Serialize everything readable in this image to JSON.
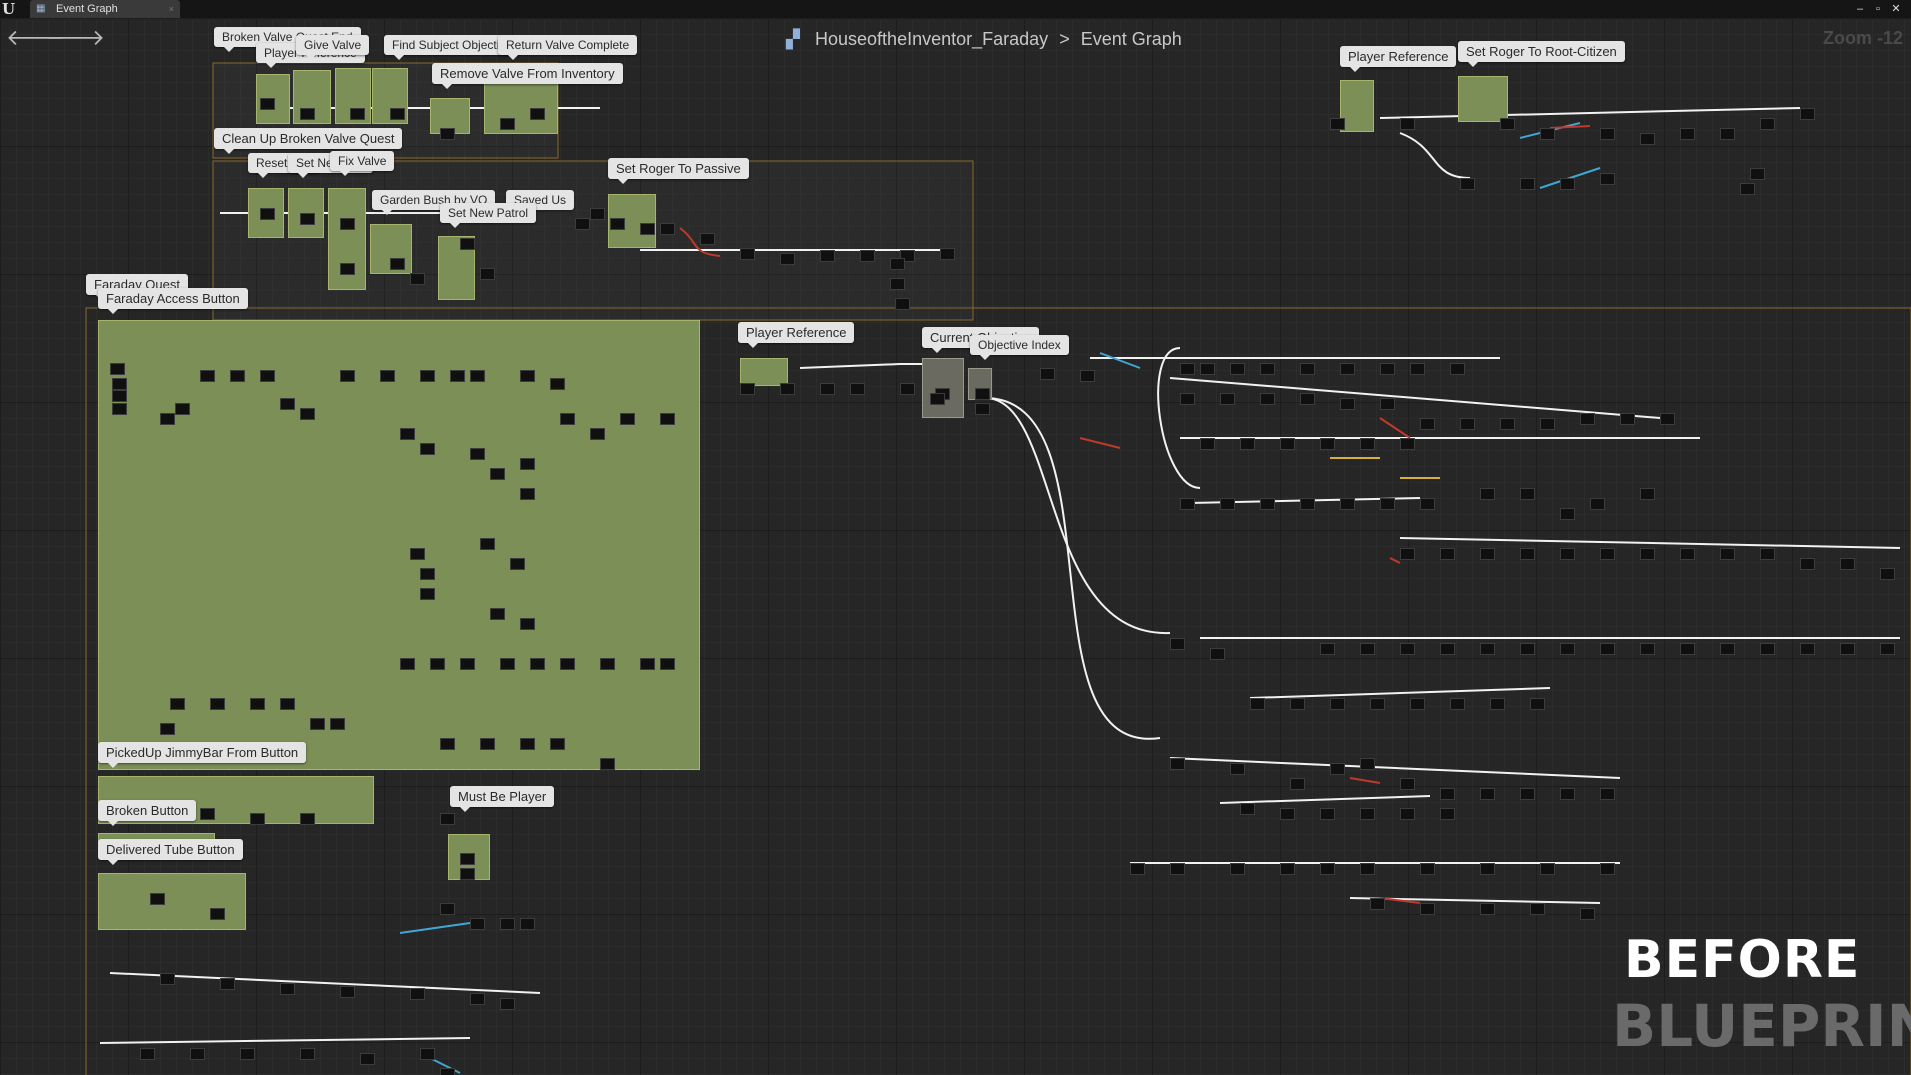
{
  "window": {
    "tab_label": "Event Graph",
    "tab_icon": "event-graph-icon",
    "close_glyph": "×",
    "controls": [
      "–",
      "▫",
      "✕"
    ]
  },
  "toolbar": {
    "back_icon": "arrow-left-icon",
    "forward_icon": "arrow-right-icon",
    "back_glyph": "🡐",
    "forward_glyph": "🡒"
  },
  "breadcrumb": {
    "icon": "blueprint-class-icon",
    "icon_glyph": "▞",
    "asset": "HouseoftheInventor_Faraday",
    "separator": ">",
    "graph": "Event Graph"
  },
  "zoom_label": "Zoom -12",
  "comments": [
    "Broken Valve Quest End",
    "Player Reference",
    "Give Valve",
    "Find Subject Objective",
    "Return Valve Complete",
    "Remove Valve From Inventory",
    "Clean Up Broken Valve Quest",
    "Reset Plot",
    "Set New Plot",
    "Fix Valve",
    "Garden Bush by VO",
    "Saved Us",
    "Set New Patrol",
    "Set Roger To Passive",
    "Player Reference",
    "Set Roger To Root-Citizen",
    "Faraday Quest",
    "Faraday Access Button",
    "Player Reference",
    "Current Objective",
    "Objective Index",
    "PickedUp JimmyBar From Button",
    "Broken Button",
    "Must Be Player",
    "Delivered Tube Button"
  ],
  "overlay": {
    "before": "BEFORE",
    "watermark": "BLUEPRINT"
  },
  "colors": {
    "exec_wire": "#ffffff",
    "data_wire_blue": "#3fa7d6",
    "data_wire_red": "#c0392b",
    "data_wire_yellow": "#d7b23a",
    "comment_fill": "#7b8f56",
    "comment_border": "#a6b46c",
    "group_border": "#8a6a2e"
  }
}
